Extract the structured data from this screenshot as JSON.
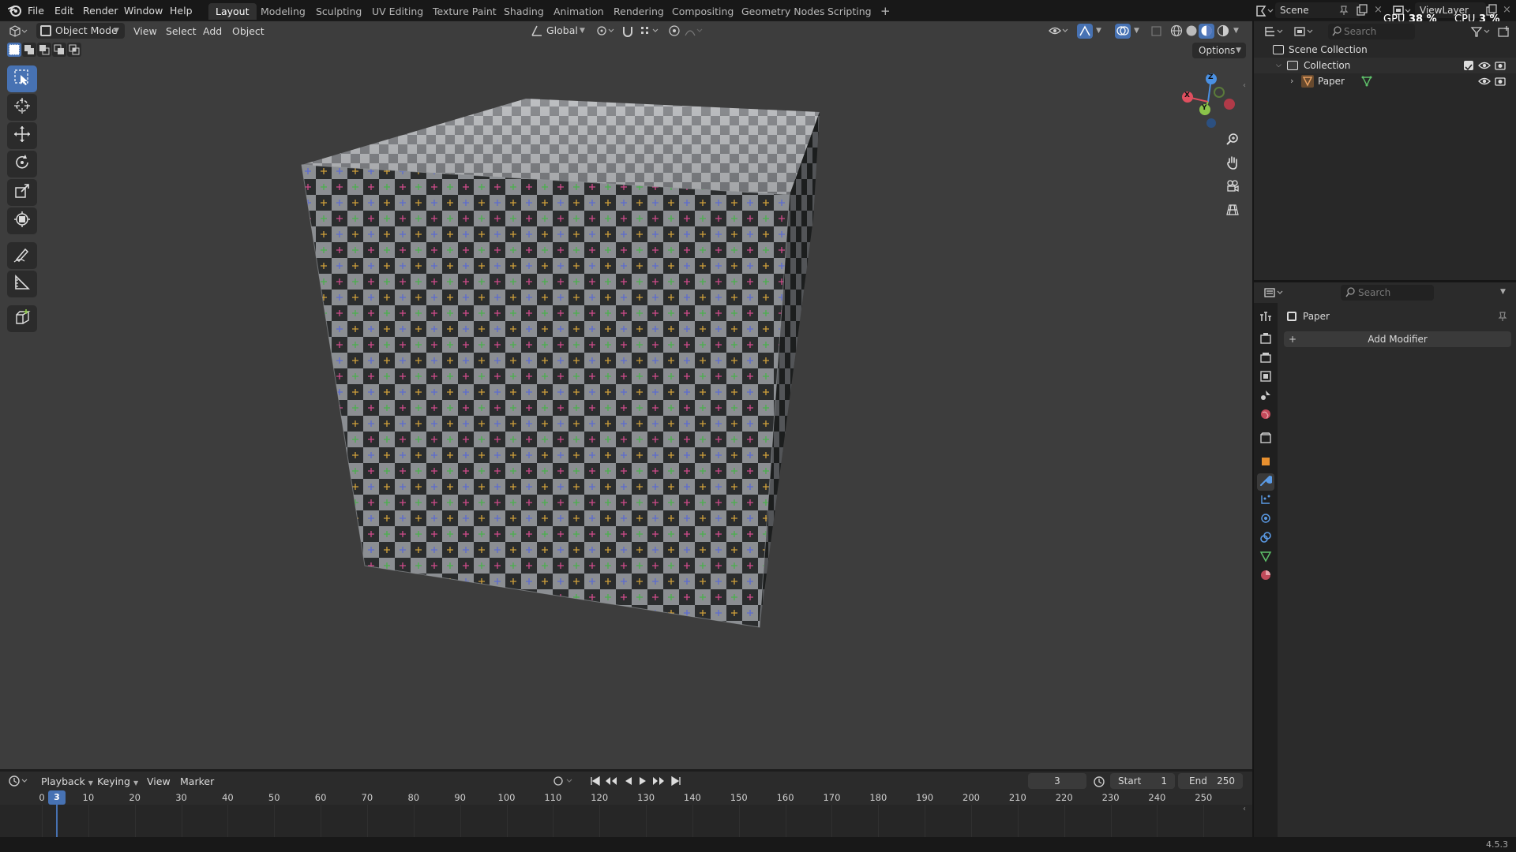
{
  "topbar": {
    "menus": [
      "File",
      "Edit",
      "Render",
      "Window",
      "Help"
    ],
    "workspaces": [
      "Layout",
      "Modeling",
      "Sculpting",
      "UV Editing",
      "Texture Paint",
      "Shading",
      "Animation",
      "Rendering",
      "Compositing",
      "Geometry Nodes",
      "Scripting"
    ],
    "active_workspace": "Layout",
    "add_workspace": "+",
    "scene": "Scene",
    "view_layer": "ViewLayer",
    "gpu_label": "GPU",
    "gpu_value": "38 %",
    "cpu_label": "CPU",
    "cpu_value": "3 %"
  },
  "viewport": {
    "mode": "Object Mode",
    "menus": [
      "View",
      "Select",
      "Add",
      "Object"
    ],
    "orientation": "Global",
    "options": "Options",
    "gizmo": {
      "z": "Z",
      "x": "X",
      "y": "Y"
    },
    "tools": [
      "select-box-icon",
      "cursor-icon",
      "move-icon",
      "rotate-icon",
      "scale-icon",
      "transform-icon",
      "annotate-icon",
      "measure-icon",
      "add-cube-icon"
    ],
    "nav": [
      "zoom-icon",
      "pan-hand-icon",
      "camera-icon",
      "ortho-grid-icon"
    ]
  },
  "outliner": {
    "search_placeholder": "Search",
    "scene_collection": "Scene Collection",
    "collection": "Collection",
    "object": "Paper"
  },
  "properties": {
    "search_placeholder": "Search",
    "object_name": "Paper",
    "add_modifier": "Add Modifier",
    "tabs": [
      "tool-icon",
      "render-icon",
      "output-icon",
      "view-layer-icon",
      "scene-icon",
      "world-icon",
      "collection-icon",
      "object-icon",
      "modifier-icon",
      "particles-icon",
      "physics-icon",
      "constraints-icon",
      "data-icon",
      "material-icon"
    ],
    "active_tab": "modifier-icon"
  },
  "timeline": {
    "menus": [
      "Playback",
      "Keying",
      "View",
      "Marker"
    ],
    "current_frame": "3",
    "start_label": "Start",
    "start": "1",
    "end_label": "End",
    "end": "250",
    "ruler": [
      "0",
      "10",
      "20",
      "30",
      "40",
      "50",
      "60",
      "70",
      "80",
      "90",
      "100",
      "110",
      "120",
      "130",
      "140",
      "150",
      "160",
      "170",
      "180",
      "190",
      "200",
      "210",
      "220",
      "230",
      "240",
      "250"
    ]
  },
  "status": {
    "version": "4.5.3"
  },
  "colors": {
    "accent": "#4772b3",
    "header": "#181818",
    "viewport": "#3d3d3d",
    "axis_x": "#e04f5f",
    "axis_y": "#8bc34a",
    "axis_z": "#4a90e2"
  }
}
